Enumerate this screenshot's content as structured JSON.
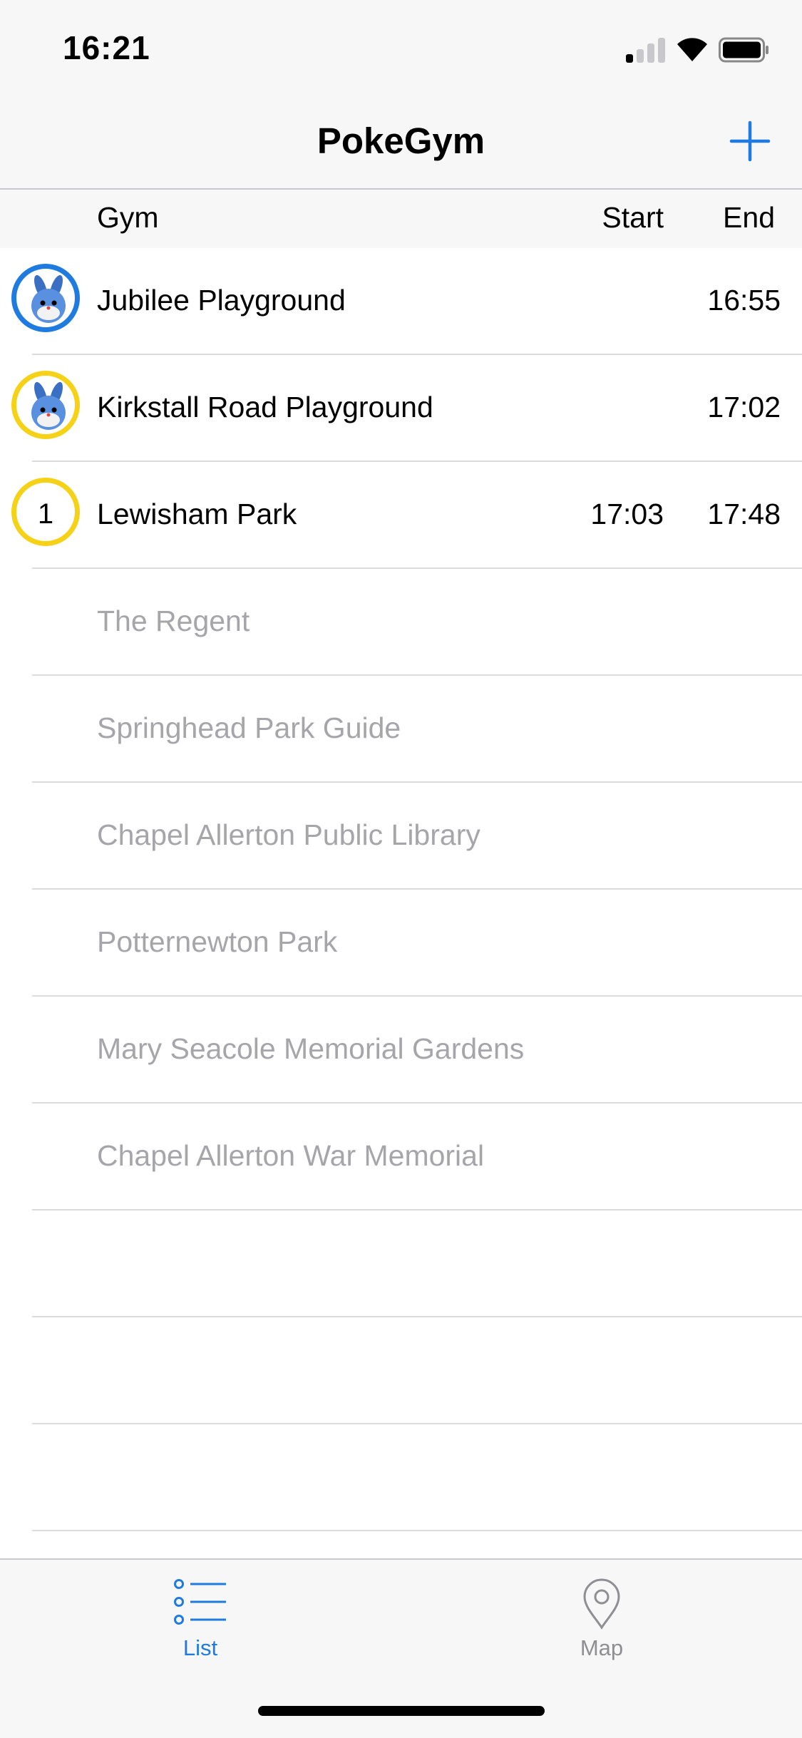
{
  "status_bar": {
    "time": "16:21",
    "signal_bars": 1,
    "icons": [
      "signal-icon",
      "wifi-icon",
      "battery-icon"
    ]
  },
  "nav": {
    "title": "PokeGym",
    "add_icon": "plus-icon"
  },
  "columns": {
    "gym": "Gym",
    "start": "Start",
    "end": "End"
  },
  "rows": [
    {
      "name": "Jubilee Playground",
      "start": "",
      "end": "16:55",
      "badge": "pokemon",
      "ring": "blue"
    },
    {
      "name": "Kirkstall Road Playground",
      "start": "",
      "end": "17:02",
      "badge": "pokemon",
      "ring": "yellow"
    },
    {
      "name": "Lewisham Park",
      "start": "17:03",
      "end": "17:48",
      "badge": "1",
      "ring": "yellow"
    },
    {
      "name": "The Regent",
      "start": "",
      "end": ""
    },
    {
      "name": "Springhead Park Guide",
      "start": "",
      "end": ""
    },
    {
      "name": "Chapel Allerton Public Library",
      "start": "",
      "end": ""
    },
    {
      "name": "Potternewton Park",
      "start": "",
      "end": ""
    },
    {
      "name": "Mary Seacole Memorial Gardens",
      "start": "",
      "end": ""
    },
    {
      "name": "Chapel Allerton War Memorial",
      "start": "",
      "end": ""
    },
    {
      "name": "",
      "start": "",
      "end": ""
    },
    {
      "name": "",
      "start": "",
      "end": ""
    },
    {
      "name": "",
      "start": "",
      "end": ""
    }
  ],
  "tabs": [
    {
      "label": "List",
      "icon": "list-icon",
      "selected": true
    },
    {
      "label": "Map",
      "icon": "map-pin-icon",
      "selected": false
    }
  ],
  "colors": {
    "accent": "#1f7be0",
    "ring_yellow": "#f5d217",
    "ring_blue": "#1f7be0",
    "inactive_text": "#a6a6aa"
  }
}
